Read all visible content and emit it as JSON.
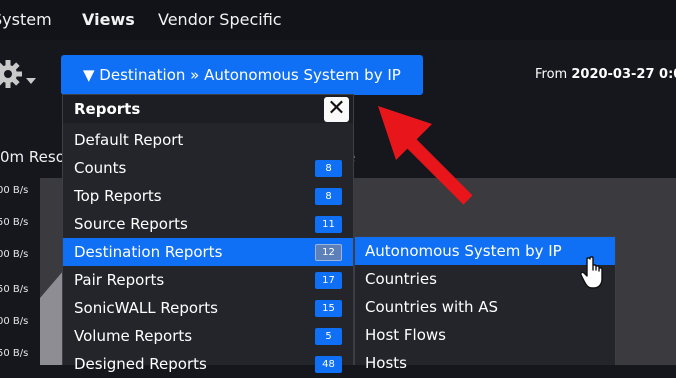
{
  "top_nav": {
    "items": [
      "System",
      "Views",
      "Vendor Specific"
    ],
    "active": "Views"
  },
  "toolbar": {
    "gear_icon": "gear-icon",
    "destination_button": "▼ Destination » Autonomous System by IP",
    "from_label": "From",
    "from_value": "2020-03-27 0:0"
  },
  "chart": {
    "title_start": "0m Reso",
    "title_end": "e",
    "y_labels": [
      "00 B/s",
      "50 B/s",
      "00 B/s",
      "50 B/s",
      "00 B/s",
      "50 B/s",
      "00 B/s",
      "50 B/s"
    ]
  },
  "reports_menu": {
    "title": "Reports",
    "close_icon": "close-icon",
    "items": [
      {
        "label": "Default Report",
        "count": ""
      },
      {
        "label": "Counts",
        "count": "8"
      },
      {
        "label": "Top Reports",
        "count": "8"
      },
      {
        "label": "Source Reports",
        "count": "11"
      },
      {
        "label": "Destination Reports",
        "count": "12"
      },
      {
        "label": "Pair Reports",
        "count": "17"
      },
      {
        "label": "SonicWALL Reports",
        "count": "15"
      },
      {
        "label": "Volume Reports",
        "count": "5"
      },
      {
        "label": "Designed Reports",
        "count": "48"
      }
    ],
    "highlighted": "Destination Reports"
  },
  "submenu": {
    "items": [
      "Autonomous System by IP",
      "Countries",
      "Countries with AS",
      "Host Flows",
      "Hosts"
    ],
    "highlighted": "Autonomous System by IP"
  },
  "colors": {
    "accent": "#0f6ff5",
    "annotation_arrow": "#e8161b",
    "background": "#16171d"
  },
  "annotation": {
    "arrow_icon": "red-arrow-icon",
    "cursor_icon": "hand-cursor-icon"
  }
}
